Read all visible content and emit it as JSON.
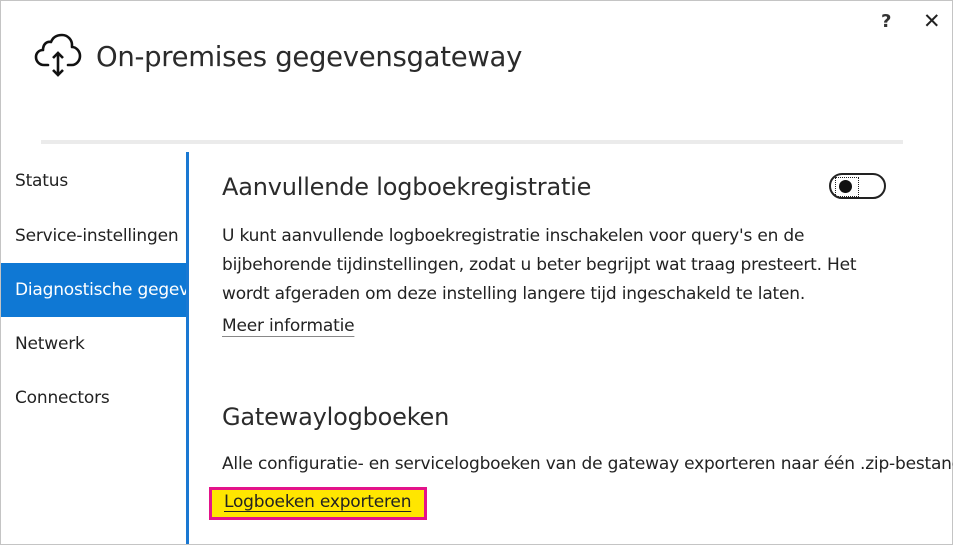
{
  "window": {
    "title": "On-premises gegevensgateway",
    "help_label": "?",
    "close_label": "✕"
  },
  "nav": {
    "items": [
      {
        "label": "Status",
        "active": false
      },
      {
        "label": "Service-instellingen",
        "active": false
      },
      {
        "label": "Diagnostische gegevens",
        "active": true
      },
      {
        "label": "Netwerk",
        "active": false
      },
      {
        "label": "Connectors",
        "active": false
      }
    ]
  },
  "logging": {
    "heading": "Aanvullende logboekregistratie",
    "toggle_on": false,
    "description_lines": [
      "U kunt aanvullende logboekregistratie inschakelen voor query's en de",
      "bijbehorende tijdinstellingen, zodat u beter begrijpt wat traag presteert. Het",
      "wordt afgeraden om deze instelling langere tijd ingeschakeld te laten."
    ],
    "more_info_link": "Meer informatie"
  },
  "gateway_logs": {
    "heading": "Gatewaylogboeken",
    "description": "Alle configuratie- en servicelogboeken van de gateway exporteren naar één .zip-bestand.",
    "export_link": "Logboeken exporteren"
  },
  "colors": {
    "accent": "#0f78d4",
    "highlight_fill": "#ffe600",
    "highlight_border": "#e3138a"
  }
}
